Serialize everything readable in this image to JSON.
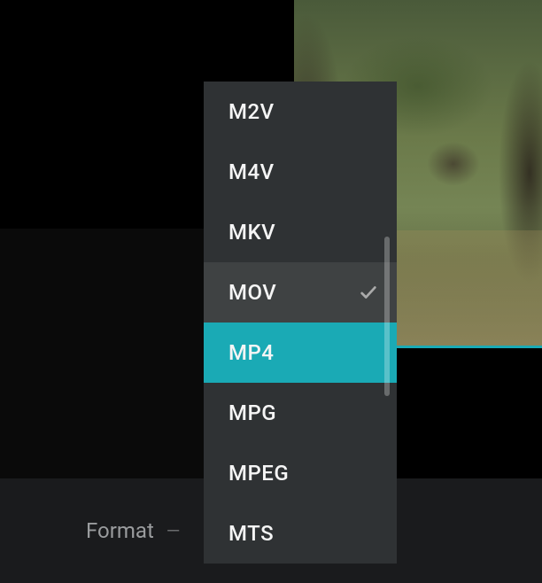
{
  "bottom": {
    "format_label": "Format",
    "dash": "—"
  },
  "dropdown": {
    "items": [
      {
        "label": "M2V",
        "state": ""
      },
      {
        "label": "M4V",
        "state": ""
      },
      {
        "label": "MKV",
        "state": ""
      },
      {
        "label": "MOV",
        "state": "hovered"
      },
      {
        "label": "MP4",
        "state": "selected"
      },
      {
        "label": "MPG",
        "state": ""
      },
      {
        "label": "MPEG",
        "state": ""
      },
      {
        "label": "MTS",
        "state": ""
      }
    ]
  },
  "colors": {
    "accent": "#1aaab5",
    "panel": "#2f3234"
  }
}
